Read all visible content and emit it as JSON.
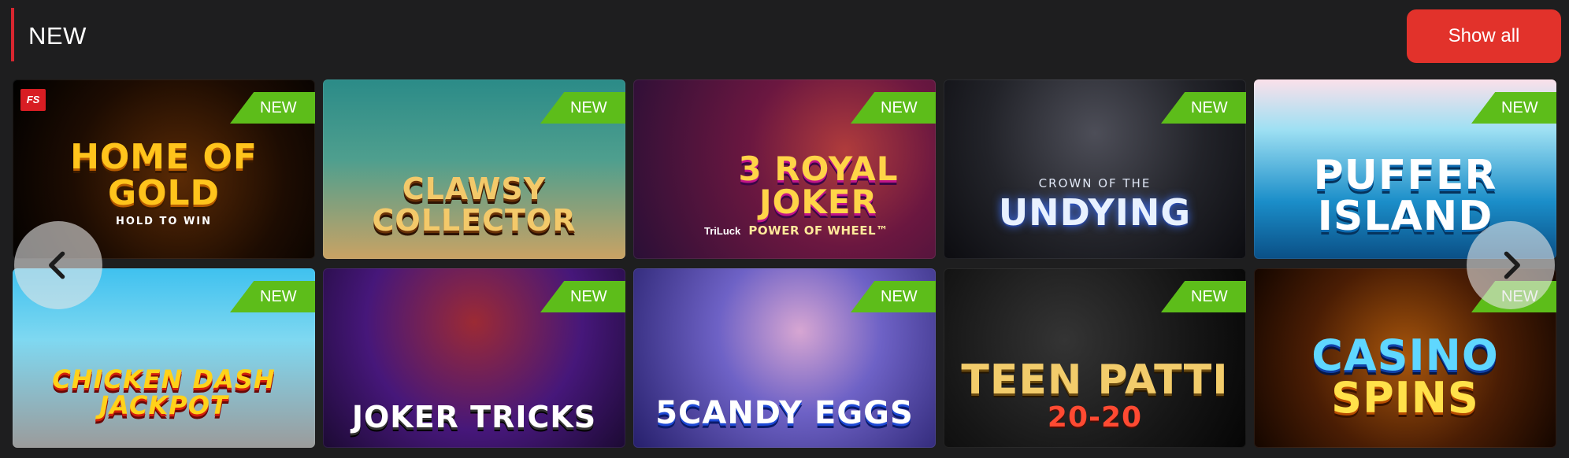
{
  "section": {
    "title": "NEW",
    "show_all_label": "Show all"
  },
  "colors": {
    "background": "#1e1e1f",
    "accent": "#d8262f",
    "show_all_button": "#e2322b",
    "new_badge": "#5dbd1a"
  },
  "badge_label": "NEW",
  "games": [
    {
      "title": "HOME OF GOLD",
      "subtitle": "HOLD TO WIN",
      "provider_tag": "FS",
      "badge": "NEW"
    },
    {
      "title": "CLAWSY COLLECTOR",
      "badge": "NEW"
    },
    {
      "title": "3 ROYAL JOKER",
      "subtitle": "POWER OF WHEEL™",
      "provider_tag": "TriLuck",
      "badge": "NEW"
    },
    {
      "title": "UNDYING",
      "subtitle": "CROWN OF THE",
      "badge": "NEW"
    },
    {
      "title": "PUFFER ISLAND",
      "badge": "NEW"
    },
    {
      "title": "CHICKEN DASH JACKPOT",
      "badge": "NEW"
    },
    {
      "title": "JOKER TRICKS",
      "badge": "NEW"
    },
    {
      "title": "5CANDY EGGS",
      "badge": "NEW"
    },
    {
      "title": "TEEN PATTI",
      "subtitle": "20-20",
      "badge": "NEW"
    },
    {
      "title": "CASINO",
      "subtitle": "SPINS",
      "badge": "NEW"
    }
  ],
  "navigation": {
    "prev_icon": "chevron-left-icon",
    "next_icon": "chevron-right-icon"
  }
}
